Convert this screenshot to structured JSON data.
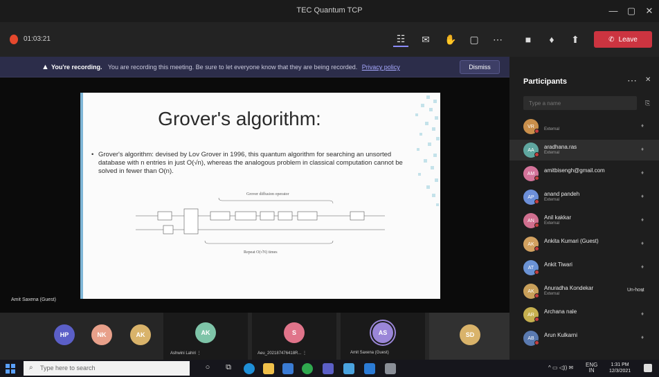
{
  "window": {
    "title": "TEC Quantum TCP"
  },
  "toolbar": {
    "timer": "01:03:21",
    "leave_label": "Leave"
  },
  "banner": {
    "heading": "You're recording.",
    "message": "You are recording this meeting. Be sure to let everyone know that they are being recorded.",
    "privacy_link": "Privacy policy",
    "dismiss_label": "Dismiss"
  },
  "slide": {
    "title": "Grover's algorithm:",
    "body": "Grover's algorithm: devised by Lov Grover in 1996, this quantum algorithm for searching an unsorted database with n entries in just O(√n), whereas the analogous problem in classical computation cannot be solved in fewer than O(n).",
    "circuit_top_label": "Grover diffusion operator",
    "circuit_bottom_label": "Repeat O(√N) times"
  },
  "presenter_tag": "Amit Saxena (Guest)",
  "strip": [
    {
      "initials": "HP",
      "color": "#5b5fc7",
      "name": ""
    },
    {
      "initials": "NK",
      "color": "#e8a08a",
      "name": ""
    },
    {
      "initials": "AK",
      "color": "#d9b36a",
      "name": ""
    },
    {
      "initials": "AK",
      "color": "#7ec4a8",
      "name": "Ashwini Lahiri  ⋮"
    },
    {
      "initials": "S",
      "color": "#e0748a",
      "name": "Aeu_202187476418R...  ⋮"
    },
    {
      "initials": "AS",
      "color": "#9a86d8",
      "name": "Amit Saxena (Guest)"
    },
    {
      "initials": "SD",
      "color": "#d9b36a",
      "name": ""
    }
  ],
  "panel": {
    "title": "Participants",
    "search_placeholder": "Type a name",
    "participants": [
      {
        "initials": "VR",
        "color": "#c98f4b",
        "name": "",
        "sub": "External",
        "extra": ""
      },
      {
        "initials": "AA",
        "color": "#5fa7a0",
        "name": "aradhana.ras",
        "sub": "External",
        "extra": ""
      },
      {
        "initials": "AM",
        "color": "#d4739a",
        "name": "amitbisengh@gmail.com",
        "sub": "",
        "extra": ""
      },
      {
        "initials": "AP",
        "color": "#6c8fd8",
        "name": "anand pandeh",
        "sub": "External",
        "extra": ""
      },
      {
        "initials": "AN",
        "color": "#d06f8f",
        "name": "Anil kakkar",
        "sub": "External",
        "extra": ""
      },
      {
        "initials": "AK",
        "color": "#d2a160",
        "name": "Ankita Kumari (Guest)",
        "sub": "",
        "extra": ""
      },
      {
        "initials": "AT",
        "color": "#6a92d4",
        "name": "Ankit Tiwari",
        "sub": "",
        "extra": ""
      },
      {
        "initials": "AK",
        "color": "#c9a05a",
        "name": "Anuradha Kondekar",
        "sub": "External",
        "extra": "Un-host"
      },
      {
        "initials": "AR",
        "color": "#c6b04f",
        "name": "Archana nale",
        "sub": "",
        "extra": ""
      },
      {
        "initials": "AB",
        "color": "#5a7ab0",
        "name": "Arun Kulkarni",
        "sub": "",
        "extra": ""
      }
    ]
  },
  "taskbar": {
    "search_placeholder": "Type here to search",
    "tray_lang": "ENG",
    "tray_region": "IN",
    "time": "1:31 PM",
    "date": "12/3/2021"
  }
}
